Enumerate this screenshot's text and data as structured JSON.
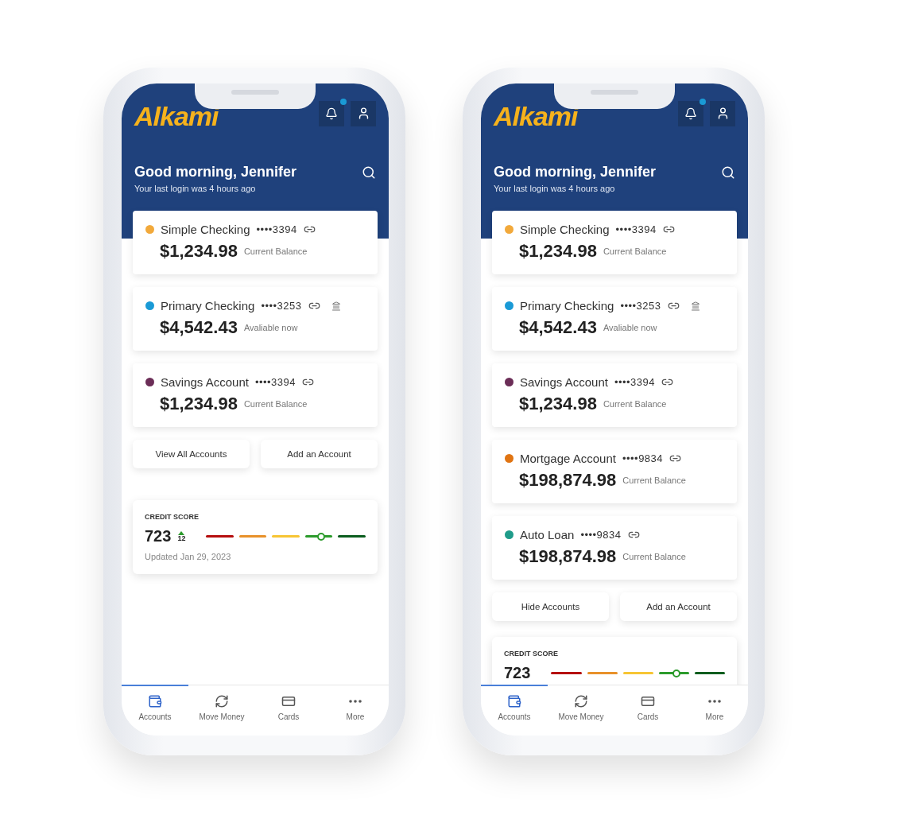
{
  "phones": [
    {
      "logo": "Alkami",
      "notification_unread": true,
      "greeting": "Good morning, Jennifer",
      "last_login": "Your last login was 4 hours ago",
      "accounts": [
        {
          "name": "Simple Checking",
          "color": "#f2a93b",
          "mask": "••••3394",
          "amount": "$1,234.98",
          "note": "Current Balance",
          "transfer": false
        },
        {
          "name": "Primary Checking",
          "color": "#1a9ad6",
          "mask": "••••3253",
          "amount": "$4,542.43",
          "note": "Avaliable now",
          "transfer": true
        },
        {
          "name": "Savings Account",
          "color": "#6b2d57",
          "mask": "••••3394",
          "amount": "$1,234.98",
          "note": "Current Balance",
          "transfer": false
        }
      ],
      "actions": [
        "View All Accounts",
        "Add an Account"
      ],
      "credit_score": {
        "title": "CREDIT SCORE",
        "score": "723",
        "change": "12",
        "level": 0.72,
        "updated": "Updated Jan 29, 2023"
      },
      "nav": [
        {
          "label": "Accounts",
          "selected": true
        },
        {
          "label": "Move Money",
          "selected": false
        },
        {
          "label": "Cards",
          "selected": false
        },
        {
          "label": "More",
          "selected": false
        }
      ]
    },
    {
      "logo": "Alkami",
      "notification_unread": true,
      "greeting": "Good morning, Jennifer",
      "last_login": "Your last login was 4 hours ago",
      "accounts": [
        {
          "name": "Simple Checking",
          "color": "#f2a93b",
          "mask": "••••3394",
          "amount": "$1,234.98",
          "note": "Current Balance",
          "transfer": false
        },
        {
          "name": "Primary Checking",
          "color": "#1a9ad6",
          "mask": "••••3253",
          "amount": "$4,542.43",
          "note": "Avaliable now",
          "transfer": true
        },
        {
          "name": "Savings Account",
          "color": "#6b2d57",
          "mask": "••••3394",
          "amount": "$1,234.98",
          "note": "Current Balance",
          "transfer": false
        },
        {
          "name": "Mortgage Account",
          "color": "#e07412",
          "mask": "••••9834",
          "amount": "$198,874.98",
          "note": "Current Balance",
          "transfer": false
        },
        {
          "name": "Auto Loan",
          "color": "#1f9c8a",
          "mask": "••••9834",
          "amount": "$198,874.98",
          "note": "Current Balance",
          "transfer": false
        }
      ],
      "actions": [
        "Hide Accounts",
        "Add an Account"
      ],
      "credit_score": {
        "title": "CREDIT SCORE",
        "score": "723",
        "level": 0.72
      },
      "nav": [
        {
          "label": "Accounts",
          "selected": true
        },
        {
          "label": "Move Money",
          "selected": false
        },
        {
          "label": "Cards",
          "selected": false
        },
        {
          "label": "More",
          "selected": false
        }
      ]
    }
  ]
}
